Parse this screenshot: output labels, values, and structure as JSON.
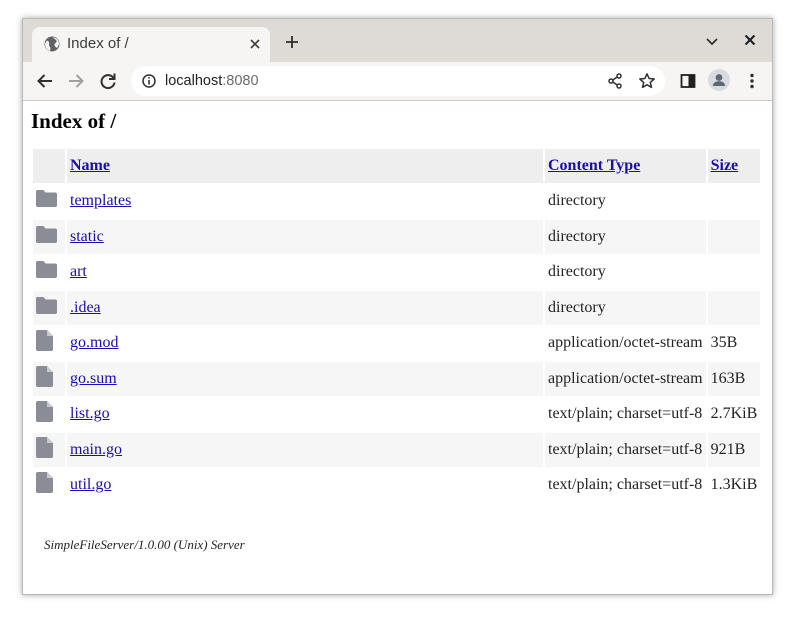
{
  "browser": {
    "tab_title": "Index of /",
    "url_host": "localhost",
    "url_port": ":8080",
    "icons": {
      "favicon": "globe-icon",
      "tab_close": "close-icon",
      "new_tab": "plus-icon",
      "tab_search": "chevron-down-icon",
      "window_close": "close-icon",
      "back": "arrow-left-icon",
      "forward": "arrow-right-icon",
      "reload": "reload-icon",
      "site_info": "info-icon",
      "share": "share-icon",
      "bookmark": "star-icon",
      "side_panel": "side-panel-icon",
      "profile": "avatar-icon",
      "menu": "kebab-menu-icon"
    }
  },
  "page": {
    "heading": "Index of /",
    "columns": {
      "name": "Name",
      "type": "Content Type",
      "size": "Size"
    },
    "rows": [
      {
        "icon": "folder-icon",
        "name": "templates",
        "type": "directory",
        "size": ""
      },
      {
        "icon": "folder-icon",
        "name": "static",
        "type": "directory",
        "size": ""
      },
      {
        "icon": "folder-icon",
        "name": "art",
        "type": "directory",
        "size": ""
      },
      {
        "icon": "folder-icon",
        "name": ".idea",
        "type": "directory",
        "size": ""
      },
      {
        "icon": "file-icon",
        "name": "go.mod",
        "type": "application/octet-stream",
        "size": "35B"
      },
      {
        "icon": "file-icon",
        "name": "go.sum",
        "type": "application/octet-stream",
        "size": "163B"
      },
      {
        "icon": "file-icon",
        "name": "list.go",
        "type": "text/plain; charset=utf-8",
        "size": "2.7KiB"
      },
      {
        "icon": "file-icon",
        "name": "main.go",
        "type": "text/plain; charset=utf-8",
        "size": "921B"
      },
      {
        "icon": "file-icon",
        "name": "util.go",
        "type": "text/plain; charset=utf-8",
        "size": "1.3KiB"
      }
    ],
    "footer": "SimpleFileServer/1.0.00 (Unix) Server"
  },
  "colors": {
    "link": "#1a0dab",
    "icon_gray": "#8a8d96",
    "tabstrip": "#dedad6",
    "toolbar": "#f6f5f4"
  }
}
